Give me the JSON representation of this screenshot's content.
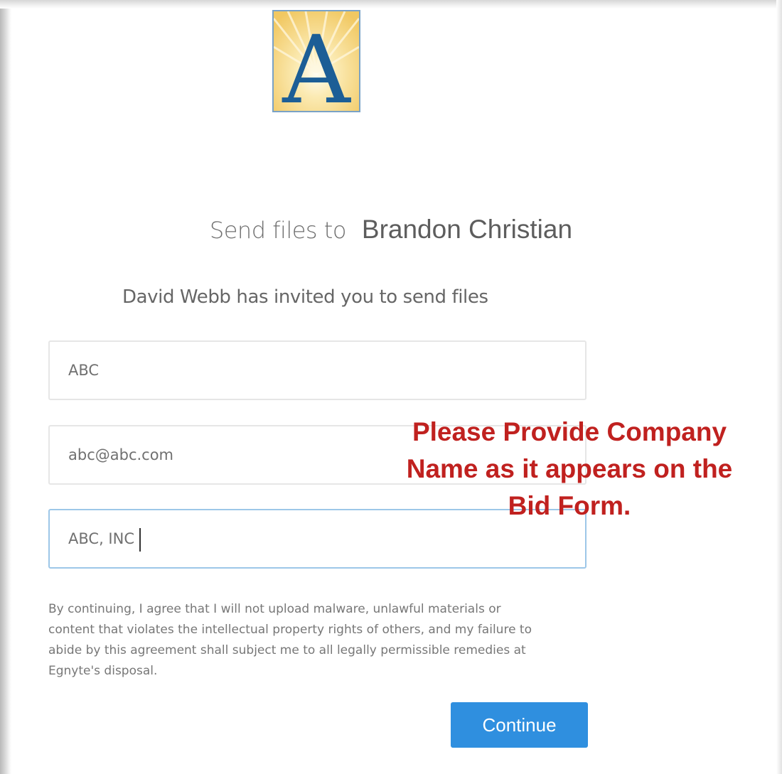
{
  "logo": {
    "icon": "letter-a-sunburst-logo",
    "letter": "A",
    "colors": {
      "letter": "#1c5e96",
      "background": "#f6d887",
      "border": "#7aa2c6"
    }
  },
  "header": {
    "title_prefix": "Send files to",
    "recipient": "Brandon Christian"
  },
  "subheading": "David Webb has invited you to send files",
  "form": {
    "name_value": "ABC",
    "email_value": "abc@abc.com",
    "company_value": "ABC, INC"
  },
  "callout": {
    "lines": [
      "Please Provide Company",
      "Name as it appears on the",
      "Bid Form."
    ],
    "color": "#c0211f"
  },
  "disclaimer": {
    "lines": [
      "By continuing, I agree that I will not upload malware, unlawful materials or",
      "content that violates the intellectual property rights of others, and my failure to",
      "abide by this agreement shall subject me to all legally permissible remedies at",
      "Egnyte's disposal."
    ]
  },
  "actions": {
    "continue_label": "Continue",
    "continue_color": "#2f8fdf"
  }
}
